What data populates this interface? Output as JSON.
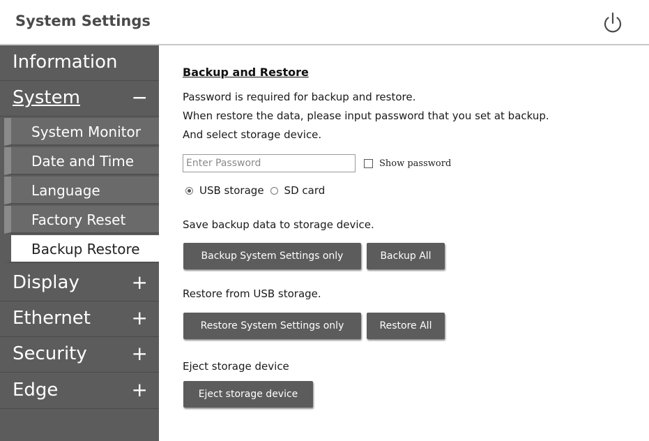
{
  "header": {
    "title": "System Settings",
    "power_icon": "power-icon"
  },
  "sidebar": {
    "items": [
      {
        "label": "Information",
        "sign": ""
      },
      {
        "label": "System",
        "sign": "−"
      },
      {
        "label": "Display",
        "sign": "+"
      },
      {
        "label": "Ethernet",
        "sign": "+"
      },
      {
        "label": "Security",
        "sign": "+"
      },
      {
        "label": "Edge",
        "sign": "+"
      }
    ],
    "system_sub": [
      {
        "label": "System Monitor"
      },
      {
        "label": "Date and Time"
      },
      {
        "label": "Language"
      },
      {
        "label": "Factory Reset"
      },
      {
        "label": "Backup Restore",
        "active": true
      }
    ]
  },
  "main": {
    "title": "Backup and Restore",
    "desc_1": "Password is required for backup and restore.",
    "desc_2": "When restore the data, please input password that you set at backup.",
    "desc_3": "And select storage device.",
    "password": {
      "placeholder": "Enter Password",
      "value": ""
    },
    "show_password": {
      "label": "Show password",
      "checked": false
    },
    "storage": {
      "options": [
        "USB storage",
        "SD card"
      ],
      "selected": "USB storage"
    },
    "save_label": "Save backup data to storage device.",
    "backup_settings_button": "Backup System Settings only",
    "backup_all_button": "Backup All",
    "restore_label": "Restore from USB storage.",
    "restore_settings_button": "Restore System Settings only",
    "restore_all_button": "Restore All",
    "eject_label": "Eject storage device",
    "eject_button": "Eject storage device"
  },
  "colors": {
    "sidebar_bg": "#5c5c5c",
    "button_bg": "#5c5c5c",
    "active_item_bg": "#ffffff"
  }
}
